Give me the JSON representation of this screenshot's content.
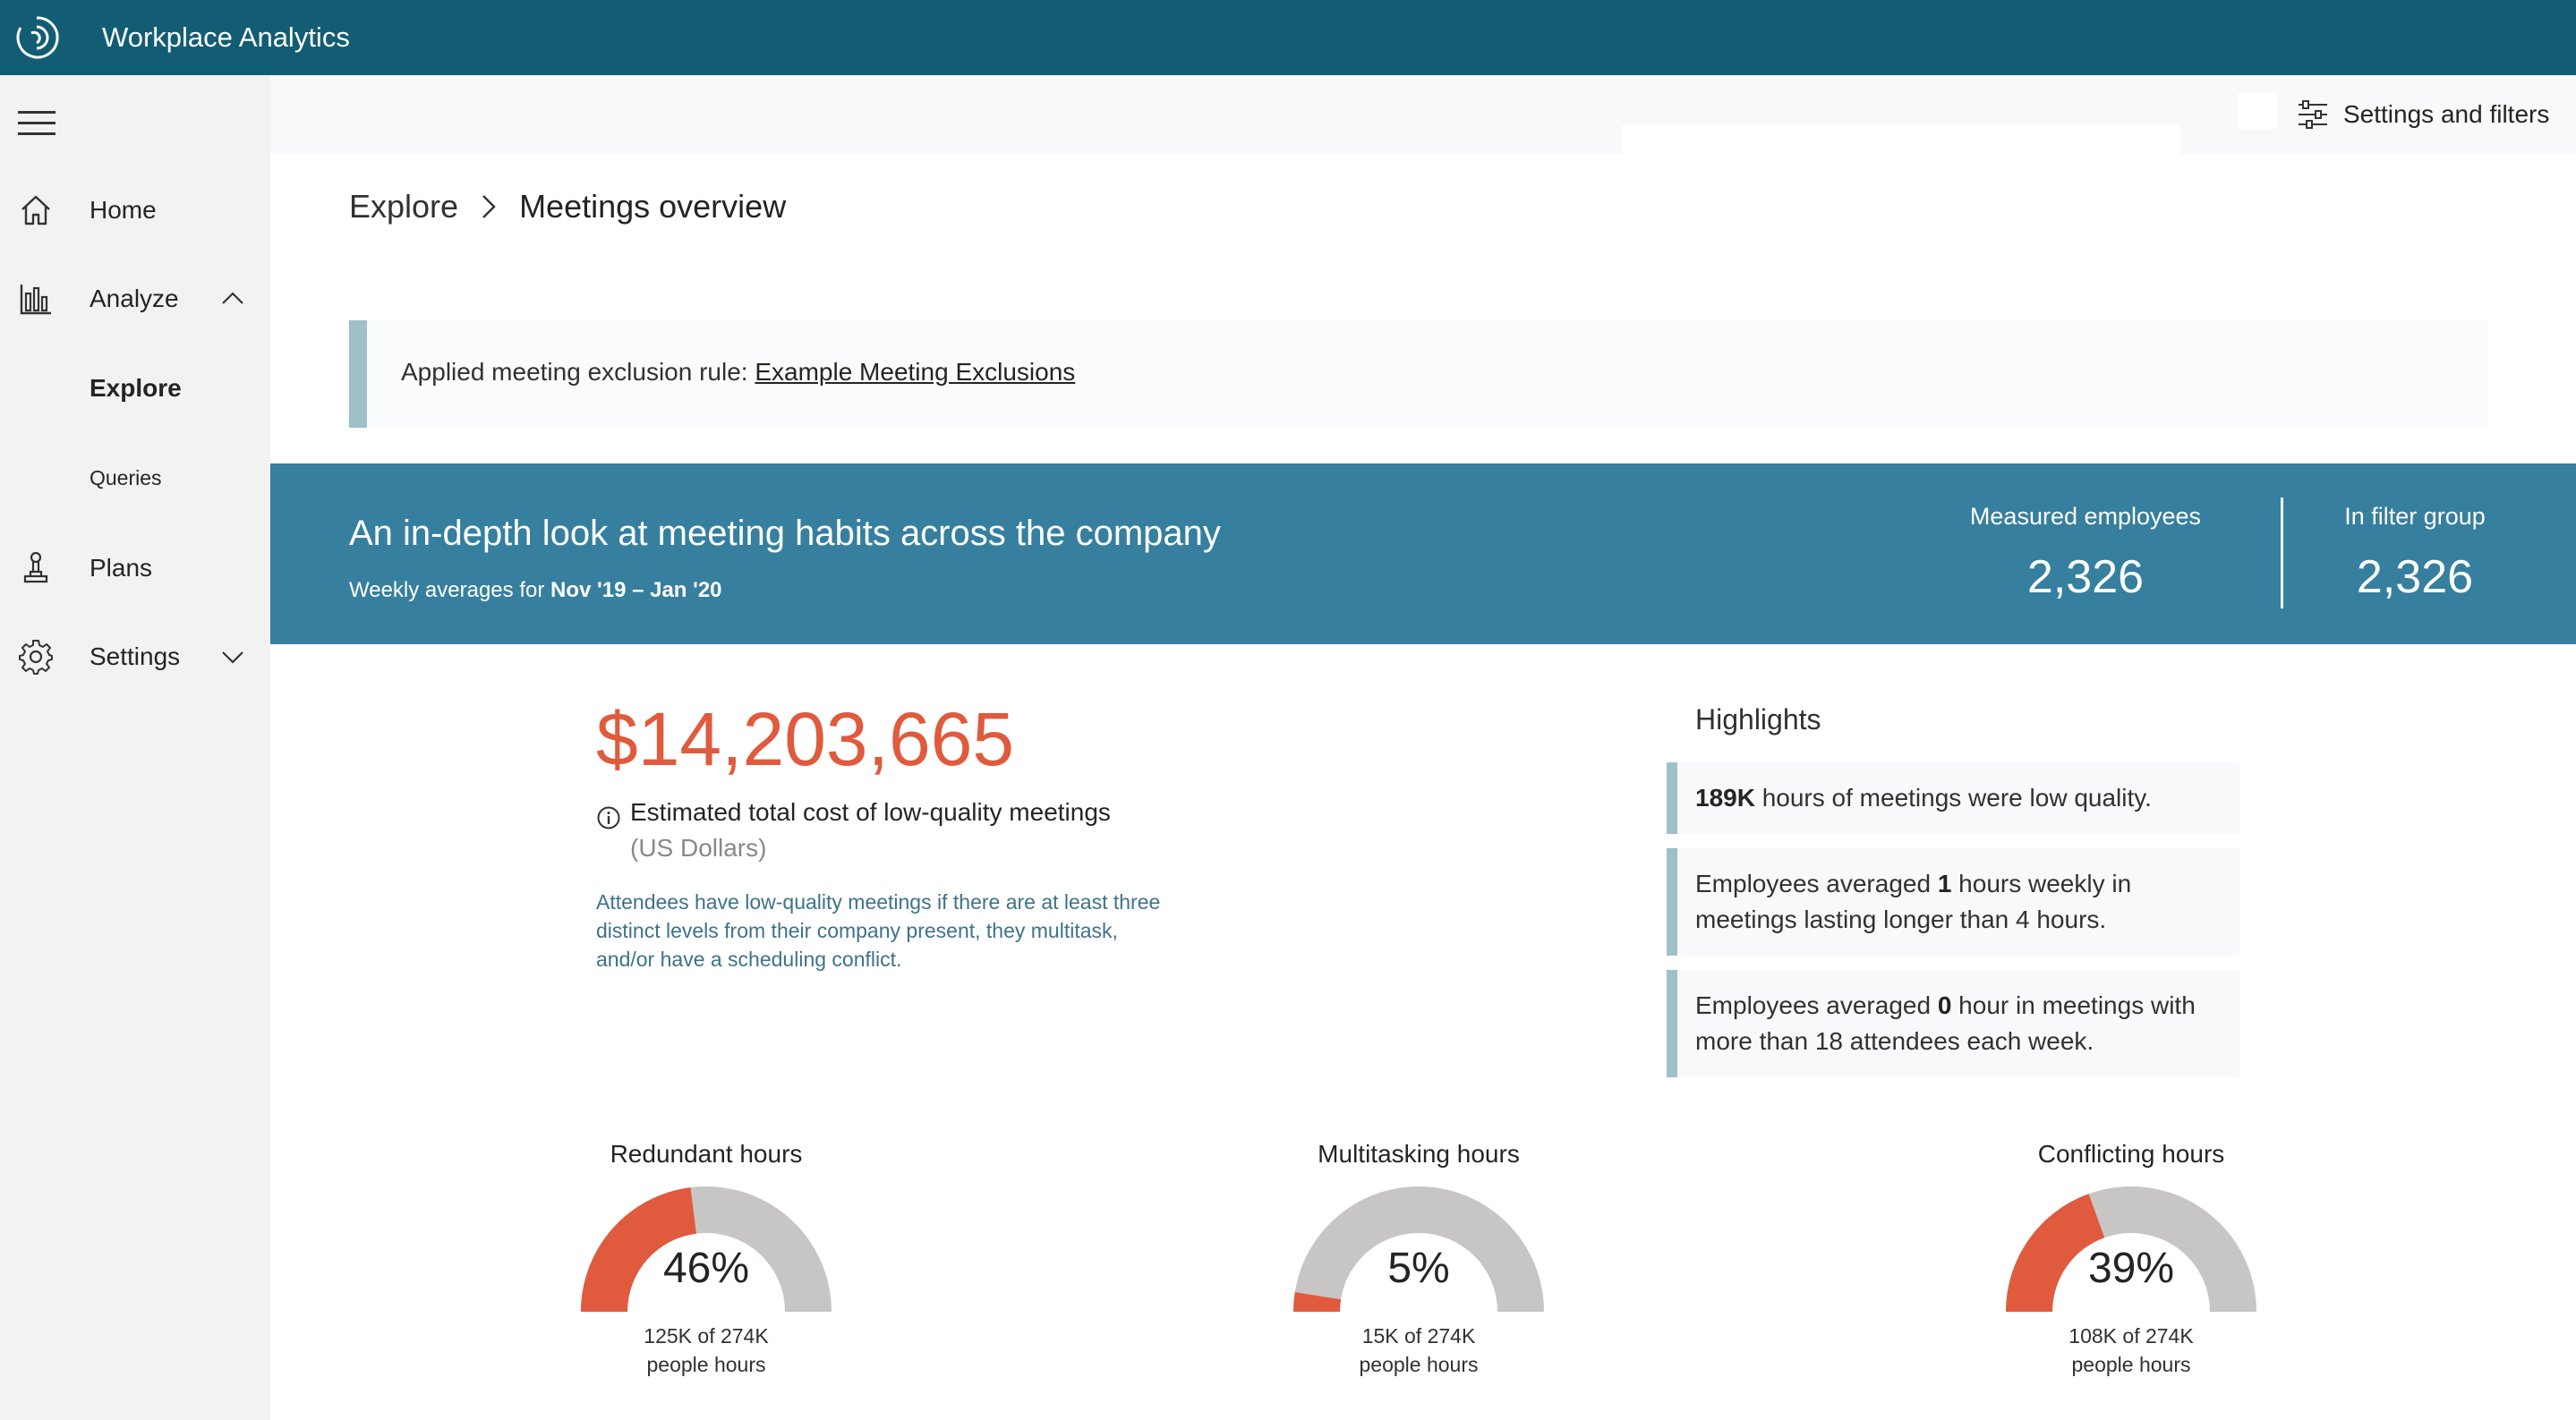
{
  "app": {
    "title": "Workplace Analytics"
  },
  "sidebar": {
    "items": [
      {
        "label": "Home"
      },
      {
        "label": "Analyze"
      },
      {
        "label": "Plans"
      },
      {
        "label": "Settings"
      }
    ],
    "subitems": [
      {
        "label": "Explore"
      },
      {
        "label": "Queries"
      }
    ]
  },
  "toolbar": {
    "settings_label": "Settings and filters"
  },
  "breadcrumb": {
    "parent": "Explore",
    "current": "Meetings overview"
  },
  "rule": {
    "prefix": "Applied meeting exclusion rule:",
    "link": "Example Meeting Exclusions"
  },
  "banner": {
    "title": "An in-depth look at meeting habits across the company",
    "sub_prefix": "Weekly averages for",
    "sub_range": "Nov '19 – Jan '20",
    "stats": [
      {
        "label": "Measured employees",
        "value": "2,326"
      },
      {
        "label": "In filter group",
        "value": "2,326"
      }
    ]
  },
  "cost": {
    "value": "$14,203,665",
    "label": "Estimated total cost of low-quality meetings",
    "unit": "(US Dollars)",
    "description": "Attendees have low-quality meetings if there are at least three distinct levels from their company present, they multitask, and/or have a scheduling conflict."
  },
  "highlights": {
    "title": "Highlights",
    "items": [
      {
        "bold": "189K",
        "rest": " hours of meetings were low quality."
      },
      {
        "pre": "Employees averaged ",
        "bold": "1",
        "rest": " hours weekly in meetings lasting longer than 4 hours."
      },
      {
        "pre": "Employees averaged ",
        "bold": "0",
        "rest": " hour in meetings with more than 18 attendees each week."
      }
    ]
  },
  "gauges": [
    {
      "title": "Redundant hours",
      "pct_label": "46%",
      "fraction": 0.46,
      "detail": "125K of 274K",
      "unit": "people hours"
    },
    {
      "title": "Multitasking hours",
      "pct_label": "5%",
      "fraction": 0.05,
      "detail": "15K of 274K",
      "unit": "people hours"
    },
    {
      "title": "Conflicting hours",
      "pct_label": "39%",
      "fraction": 0.39,
      "detail": "108K of 274K",
      "unit": "people hours"
    }
  ],
  "colors": {
    "header": "#125d73",
    "banner": "#367f9e",
    "accent": "#e05a3e",
    "gauge_track": "#c8c6c4"
  }
}
